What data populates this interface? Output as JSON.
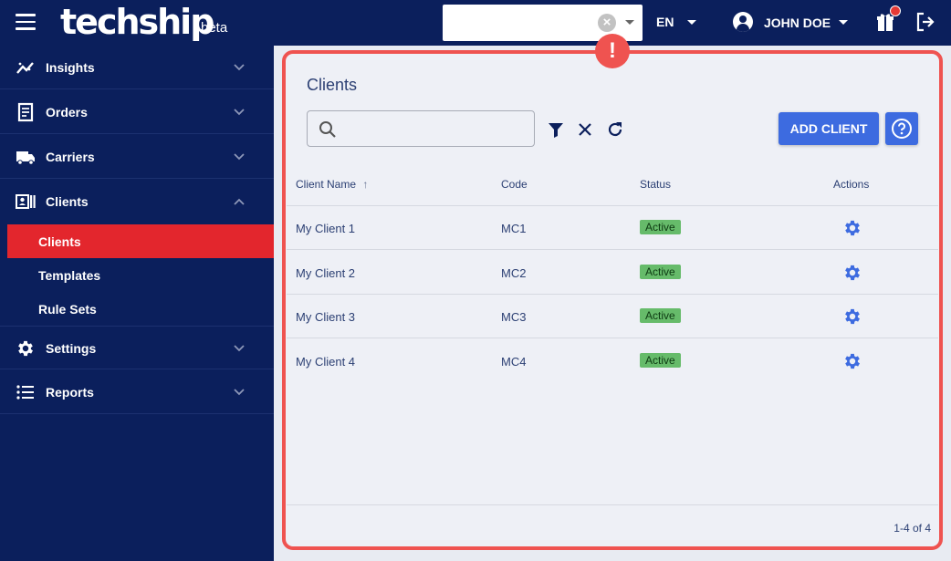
{
  "app": {
    "logo_text": "techship",
    "logo_beta": "beta",
    "colors": {
      "navy": "#0b1f5c",
      "accent_red": "#e3262d",
      "primary_blue": "#3d6be0",
      "status_green": "#66bb6a"
    }
  },
  "topbar": {
    "client_select_value": "",
    "clear_icon": "×",
    "error_icon": "!",
    "language": "EN",
    "user_name": "JOHN DOE",
    "icons": [
      "menu-icon",
      "clear-icon",
      "dropdown-icon",
      "user-icon",
      "gift-icon",
      "logout-icon"
    ]
  },
  "sidebar": {
    "items": [
      {
        "label": "Insights",
        "icon": "insights-icon"
      },
      {
        "label": "Orders",
        "icon": "orders-icon"
      },
      {
        "label": "Carriers",
        "icon": "truck-icon"
      },
      {
        "label": "Clients",
        "icon": "clients-icon"
      },
      {
        "label": "Settings",
        "icon": "gear-icon"
      },
      {
        "label": "Reports",
        "icon": "list-icon"
      }
    ],
    "sub_items": [
      {
        "label": "Clients",
        "active": true
      },
      {
        "label": "Templates",
        "active": false
      },
      {
        "label": "Rule Sets",
        "active": false
      }
    ]
  },
  "main": {
    "title": "Clients",
    "search": {
      "value": "",
      "placeholder": ""
    },
    "add_button": "ADD CLIENT",
    "columns": [
      "Client Name",
      "Code",
      "Status",
      "Actions"
    ],
    "sort_indicator": "↑",
    "rows": [
      {
        "name": "My Client 1",
        "code": "MC1",
        "status": "Active"
      },
      {
        "name": "My Client 2",
        "code": "MC2",
        "status": "Active"
      },
      {
        "name": "My Client 3",
        "code": "MC3",
        "status": "Active"
      },
      {
        "name": "My Client 4",
        "code": "MC4",
        "status": "Active"
      }
    ],
    "pagination": "1-4 of 4"
  }
}
